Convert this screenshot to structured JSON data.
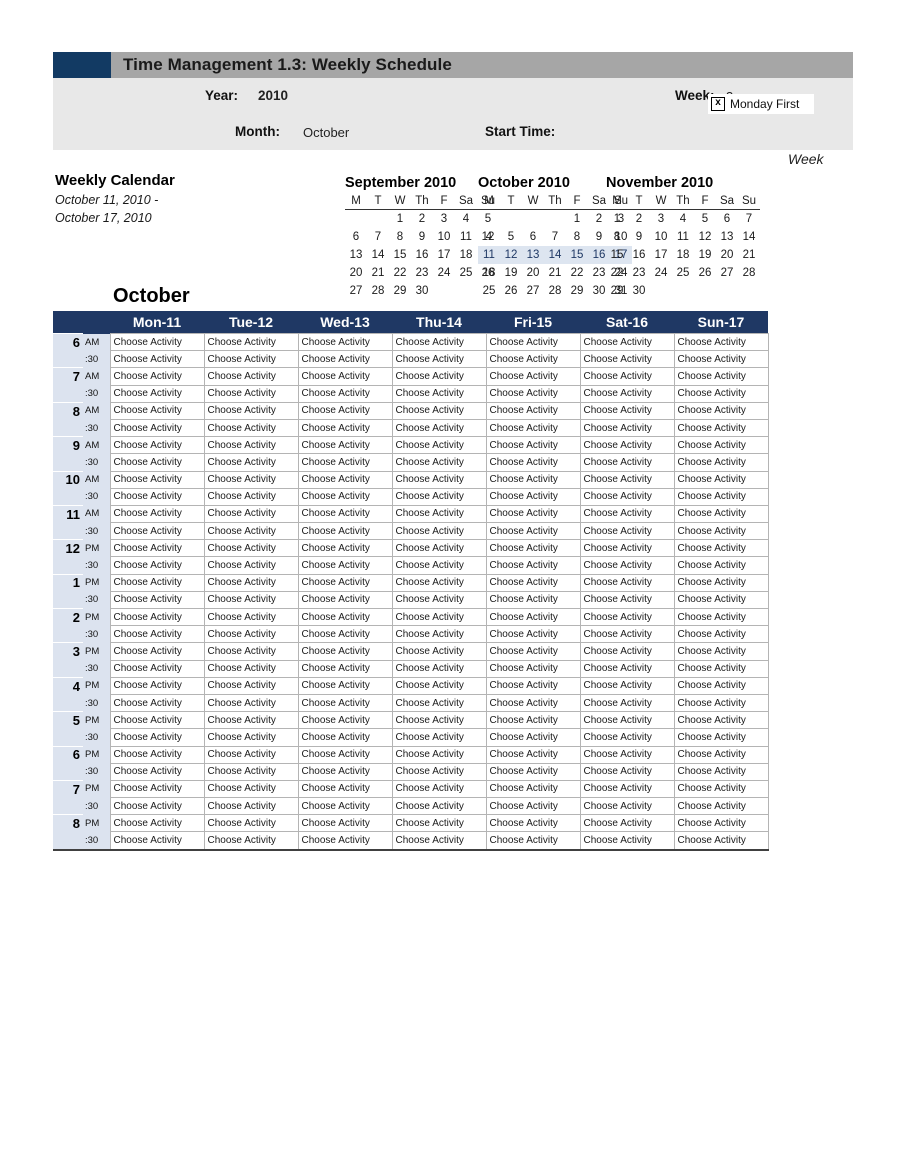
{
  "header": {
    "title": "Time Management 1.3:  Weekly Schedule",
    "swatch_color": "#123a63",
    "bar_color": "#a6a6a6"
  },
  "params": {
    "year_label": "Year:",
    "year_value": "2010",
    "week_label": "Week:",
    "week_value": "3",
    "month_label": "Month:",
    "month_value": "October",
    "start_time_label": "Start Time:",
    "start_time_value": "",
    "monday_first_label": "Monday First",
    "monday_first_checked_glyph": "x",
    "week_caption": "Week"
  },
  "calendar_heading": {
    "title": "Weekly Calendar",
    "range_line_1": "October 11, 2010 -",
    "range_line_2": "October 17, 2010",
    "big_month": "October"
  },
  "mini_calendars": [
    {
      "title": "September 2010",
      "weekdays": [
        "M",
        "T",
        "W",
        "Th",
        "F",
        "Sa",
        "Su"
      ],
      "weeks": [
        [
          "",
          "",
          "1",
          "2",
          "3",
          "4",
          "5"
        ],
        [
          "6",
          "7",
          "8",
          "9",
          "10",
          "11",
          "12"
        ],
        [
          "13",
          "14",
          "15",
          "16",
          "17",
          "18",
          "19"
        ],
        [
          "20",
          "21",
          "22",
          "23",
          "24",
          "25",
          "26"
        ],
        [
          "27",
          "28",
          "29",
          "30",
          "",
          "",
          ""
        ]
      ],
      "highlight_week_index": -1
    },
    {
      "title": "October 2010",
      "weekdays": [
        "M",
        "T",
        "W",
        "Th",
        "F",
        "Sa",
        "Su"
      ],
      "weeks": [
        [
          "",
          "",
          "",
          "",
          "1",
          "2",
          "3"
        ],
        [
          "4",
          "5",
          "6",
          "7",
          "8",
          "9",
          "10"
        ],
        [
          "11",
          "12",
          "13",
          "14",
          "15",
          "16",
          "17"
        ],
        [
          "18",
          "19",
          "20",
          "21",
          "22",
          "23",
          "24"
        ],
        [
          "25",
          "26",
          "27",
          "28",
          "29",
          "30",
          "31"
        ]
      ],
      "highlight_week_index": 2
    },
    {
      "title": "November 2010",
      "weekdays": [
        "M",
        "T",
        "W",
        "Th",
        "F",
        "Sa",
        "Su"
      ],
      "weeks": [
        [
          "1",
          "2",
          "3",
          "4",
          "5",
          "6",
          "7"
        ],
        [
          "8",
          "9",
          "10",
          "11",
          "12",
          "13",
          "14"
        ],
        [
          "15",
          "16",
          "17",
          "18",
          "19",
          "20",
          "21"
        ],
        [
          "22",
          "23",
          "24",
          "25",
          "26",
          "27",
          "28"
        ],
        [
          "29",
          "30",
          "",
          "",
          "",
          "",
          ""
        ]
      ],
      "highlight_week_index": -1
    }
  ],
  "schedule": {
    "day_headers": [
      "Mon-11",
      "Tue-12",
      "Wed-13",
      "Thu-14",
      "Fri-15",
      "Sat-16",
      "Sun-17"
    ],
    "header_bg": "#1f3864",
    "time_col_bg": "#dce3ef",
    "activity_placeholder": "Choose Activity",
    "half_hour_label": ":30",
    "rows": [
      {
        "hour": "6",
        "meridiem": "AM"
      },
      {
        "hour": "7",
        "meridiem": "AM"
      },
      {
        "hour": "8",
        "meridiem": "AM"
      },
      {
        "hour": "9",
        "meridiem": "AM"
      },
      {
        "hour": "10",
        "meridiem": "AM"
      },
      {
        "hour": "11",
        "meridiem": "AM"
      },
      {
        "hour": "12",
        "meridiem": "PM"
      },
      {
        "hour": "1",
        "meridiem": "PM"
      },
      {
        "hour": "2",
        "meridiem": "PM"
      },
      {
        "hour": "3",
        "meridiem": "PM"
      },
      {
        "hour": "4",
        "meridiem": "PM"
      },
      {
        "hour": "5",
        "meridiem": "PM"
      },
      {
        "hour": "6",
        "meridiem": "PM"
      },
      {
        "hour": "7",
        "meridiem": "PM"
      },
      {
        "hour": "8",
        "meridiem": "PM"
      }
    ]
  }
}
